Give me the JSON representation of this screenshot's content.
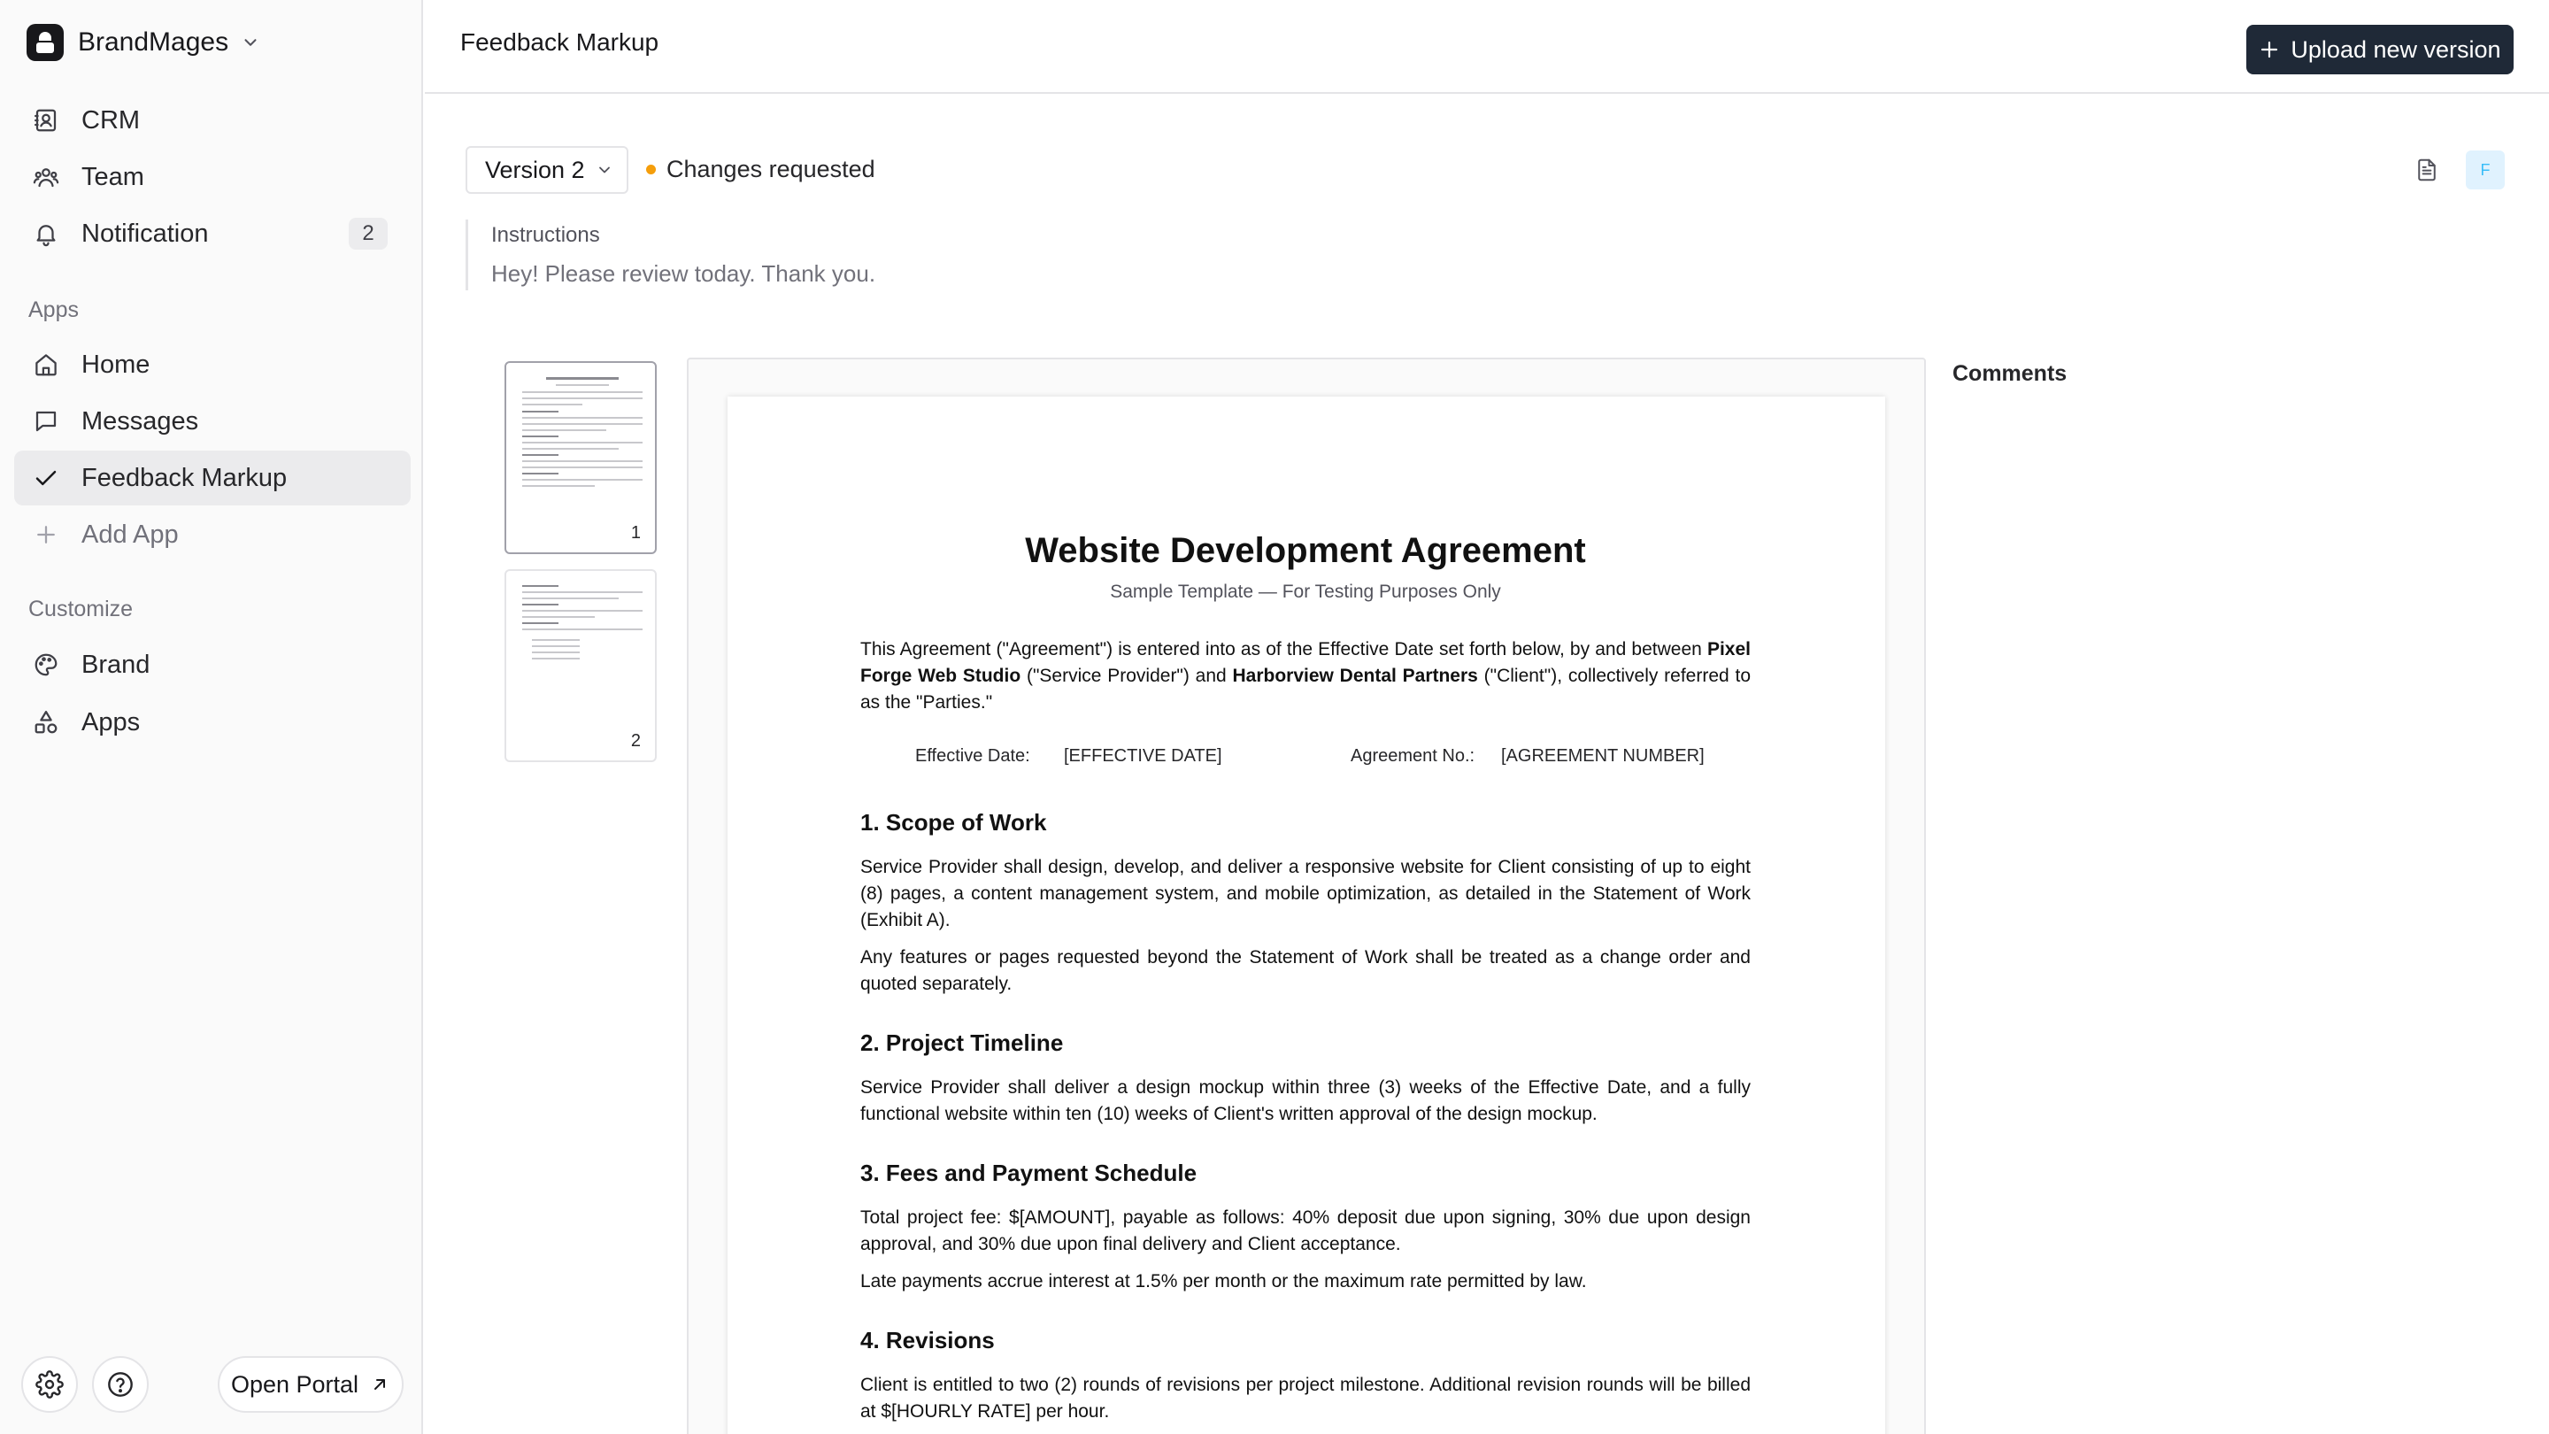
{
  "sidebar": {
    "workspace": "BrandMages",
    "nav_top": [
      {
        "label": "CRM"
      },
      {
        "label": "Team"
      },
      {
        "label": "Notification",
        "badge": "2"
      }
    ],
    "apps_section": "Apps",
    "apps": [
      {
        "label": "Home"
      },
      {
        "label": "Messages"
      },
      {
        "label": "Feedback Markup",
        "active": true
      },
      {
        "label": "Add App"
      }
    ],
    "customize_section": "Customize",
    "customize": [
      {
        "label": "Brand"
      },
      {
        "label": "Apps"
      }
    ],
    "open_portal": "Open Portal"
  },
  "header": {
    "title": "Feedback Markup",
    "upload_label": "Upload new version"
  },
  "toolbar": {
    "version": "Version 2",
    "status": "Changes requested",
    "status_color": "#f59e0b",
    "avatar_initial": "F"
  },
  "instructions": {
    "label": "Instructions",
    "text": "Hey! Please review today. Thank you."
  },
  "thumbnails": [
    {
      "page": "1"
    },
    {
      "page": "2"
    }
  ],
  "document": {
    "title": "Website Development Agreement",
    "subtitle": "Sample Template — For Testing Purposes Only",
    "intro_a": "This Agreement (\"Agreement\") is entered into as of the Effective Date set forth below, by and between ",
    "provider": "Pixel Forge Web Studio",
    "intro_b": " (\"Service Provider\") and ",
    "client": "Harborview Dental Partners",
    "intro_c": " (\"Client\"), collectively referred to as the \"Parties.\"",
    "effective_label": "Effective Date:",
    "effective_value": "[EFFECTIVE DATE]",
    "agreement_label": "Agreement No.:",
    "agreement_value": "[AGREEMENT NUMBER]",
    "s1_title": "1. Scope of Work",
    "s1_p1": "Service Provider shall design, develop, and deliver a responsive website for Client consisting of up to eight (8) pages, a content management system, and mobile optimization, as detailed in the Statement of Work (Exhibit A).",
    "s1_p2": "Any features or pages requested beyond the Statement of Work shall be treated as a change order and quoted separately.",
    "s2_title": "2. Project Timeline",
    "s2_p1": "Service Provider shall deliver a design mockup within three (3) weeks of the Effective Date, and a fully functional website within ten (10) weeks of Client's written approval of the design mockup.",
    "s3_title": "3. Fees and Payment Schedule",
    "s3_p1": "Total project fee: $[AMOUNT], payable as follows: 40% deposit due upon signing, 30% due upon design approval, and 30% due upon final delivery and Client acceptance.",
    "s3_p2": "Late payments accrue interest at 1.5% per month or the maximum rate permitted by law.",
    "s4_title": "4. Revisions",
    "s4_p1": "Client is entitled to two (2) rounds of revisions per project milestone. Additional revision rounds will be billed at $[HOURLY RATE] per hour."
  },
  "comments": {
    "title": "Comments"
  }
}
